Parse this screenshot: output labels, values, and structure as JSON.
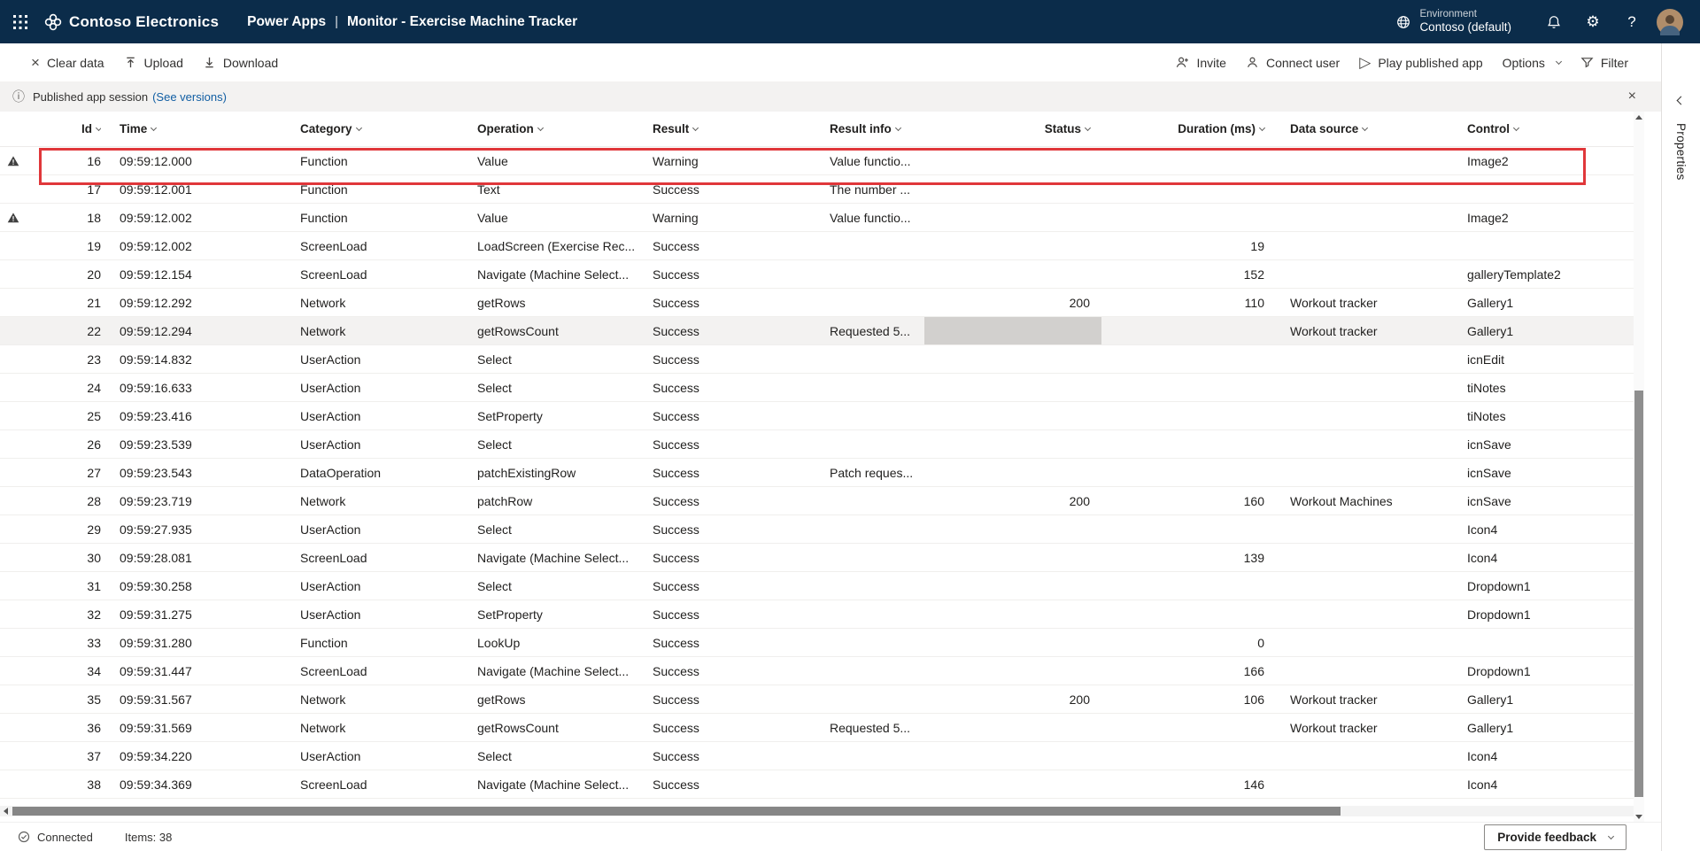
{
  "topbar": {
    "brand": "Contoso Electronics",
    "product": "Power Apps",
    "divider": "|",
    "page_title": "Monitor - Exercise Machine Tracker",
    "environment": {
      "label": "Environment",
      "name": "Contoso (default)"
    },
    "help": "?"
  },
  "toolbar": {
    "clear_data": "Clear data",
    "upload": "Upload",
    "download": "Download",
    "invite": "Invite",
    "connect_user": "Connect user",
    "play_published_app": "Play published app",
    "options": "Options",
    "filter": "Filter"
  },
  "infobar": {
    "message": "Published app session",
    "link": "(See versions)"
  },
  "table": {
    "columns": [
      "Id",
      "Time",
      "Category",
      "Operation",
      "Result",
      "Result info",
      "Status",
      "Duration (ms)",
      "Data source",
      "Control"
    ],
    "rows": [
      {
        "warning": true,
        "id": "16",
        "time": "09:59:12.000",
        "category": "Function",
        "operation": "Value",
        "result": "Warning",
        "result_info": "Value functio...",
        "status": "",
        "duration": "",
        "data_source": "",
        "control": "Image2"
      },
      {
        "warning": false,
        "id": "17",
        "time": "09:59:12.001",
        "category": "Function",
        "operation": "Text",
        "result": "Success",
        "result_info": "The number ...",
        "status": "",
        "duration": "",
        "data_source": "",
        "control": ""
      },
      {
        "warning": true,
        "id": "18",
        "time": "09:59:12.002",
        "category": "Function",
        "operation": "Value",
        "result": "Warning",
        "result_info": "Value functio...",
        "status": "",
        "duration": "",
        "data_source": "",
        "control": "Image2"
      },
      {
        "warning": false,
        "id": "19",
        "time": "09:59:12.002",
        "category": "ScreenLoad",
        "operation": "LoadScreen (Exercise Rec...",
        "result": "Success",
        "result_info": "",
        "status": "",
        "duration": "19",
        "data_source": "",
        "control": ""
      },
      {
        "warning": false,
        "id": "20",
        "time": "09:59:12.154",
        "category": "ScreenLoad",
        "operation": "Navigate (Machine Select...",
        "result": "Success",
        "result_info": "",
        "status": "",
        "duration": "152",
        "data_source": "",
        "control": "galleryTemplate2"
      },
      {
        "warning": false,
        "id": "21",
        "time": "09:59:12.292",
        "category": "Network",
        "operation": "getRows",
        "result": "Success",
        "result_info": "",
        "status": "200",
        "duration": "110",
        "data_source": "Workout tracker",
        "control": "Gallery1"
      },
      {
        "warning": false,
        "id": "22",
        "time": "09:59:12.294",
        "category": "Network",
        "operation": "getRowsCount",
        "result": "Success",
        "result_info": "Requested 5...",
        "status": "",
        "duration": "",
        "data_source": "Workout tracker",
        "control": "Gallery1",
        "selected": true,
        "selected_cell": "status"
      },
      {
        "warning": false,
        "id": "23",
        "time": "09:59:14.832",
        "category": "UserAction",
        "operation": "Select",
        "result": "Success",
        "result_info": "",
        "status": "",
        "duration": "",
        "data_source": "",
        "control": "icnEdit"
      },
      {
        "warning": false,
        "id": "24",
        "time": "09:59:16.633",
        "category": "UserAction",
        "operation": "Select",
        "result": "Success",
        "result_info": "",
        "status": "",
        "duration": "",
        "data_source": "",
        "control": "tiNotes"
      },
      {
        "warning": false,
        "id": "25",
        "time": "09:59:23.416",
        "category": "UserAction",
        "operation": "SetProperty",
        "result": "Success",
        "result_info": "",
        "status": "",
        "duration": "",
        "data_source": "",
        "control": "tiNotes"
      },
      {
        "warning": false,
        "id": "26",
        "time": "09:59:23.539",
        "category": "UserAction",
        "operation": "Select",
        "result": "Success",
        "result_info": "",
        "status": "",
        "duration": "",
        "data_source": "",
        "control": "icnSave"
      },
      {
        "warning": false,
        "id": "27",
        "time": "09:59:23.543",
        "category": "DataOperation",
        "operation": "patchExistingRow",
        "result": "Success",
        "result_info": "Patch reques...",
        "status": "",
        "duration": "",
        "data_source": "",
        "control": "icnSave"
      },
      {
        "warning": false,
        "id": "28",
        "time": "09:59:23.719",
        "category": "Network",
        "operation": "patchRow",
        "result": "Success",
        "result_info": "",
        "status": "200",
        "duration": "160",
        "data_source": "Workout Machines",
        "control": "icnSave"
      },
      {
        "warning": false,
        "id": "29",
        "time": "09:59:27.935",
        "category": "UserAction",
        "operation": "Select",
        "result": "Success",
        "result_info": "",
        "status": "",
        "duration": "",
        "data_source": "",
        "control": "Icon4"
      },
      {
        "warning": false,
        "id": "30",
        "time": "09:59:28.081",
        "category": "ScreenLoad",
        "operation": "Navigate (Machine Select...",
        "result": "Success",
        "result_info": "",
        "status": "",
        "duration": "139",
        "data_source": "",
        "control": "Icon4"
      },
      {
        "warning": false,
        "id": "31",
        "time": "09:59:30.258",
        "category": "UserAction",
        "operation": "Select",
        "result": "Success",
        "result_info": "",
        "status": "",
        "duration": "",
        "data_source": "",
        "control": "Dropdown1"
      },
      {
        "warning": false,
        "id": "32",
        "time": "09:59:31.275",
        "category": "UserAction",
        "operation": "SetProperty",
        "result": "Success",
        "result_info": "",
        "status": "",
        "duration": "",
        "data_source": "",
        "control": "Dropdown1"
      },
      {
        "warning": false,
        "id": "33",
        "time": "09:59:31.280",
        "category": "Function",
        "operation": "LookUp",
        "result": "Success",
        "result_info": "",
        "status": "",
        "duration": "0",
        "data_source": "",
        "control": ""
      },
      {
        "warning": false,
        "id": "34",
        "time": "09:59:31.447",
        "category": "ScreenLoad",
        "operation": "Navigate (Machine Select...",
        "result": "Success",
        "result_info": "",
        "status": "",
        "duration": "166",
        "data_source": "",
        "control": "Dropdown1"
      },
      {
        "warning": false,
        "id": "35",
        "time": "09:59:31.567",
        "category": "Network",
        "operation": "getRows",
        "result": "Success",
        "result_info": "",
        "status": "200",
        "duration": "106",
        "data_source": "Workout tracker",
        "control": "Gallery1"
      },
      {
        "warning": false,
        "id": "36",
        "time": "09:59:31.569",
        "category": "Network",
        "operation": "getRowsCount",
        "result": "Success",
        "result_info": "Requested 5...",
        "status": "",
        "duration": "",
        "data_source": "Workout tracker",
        "control": "Gallery1"
      },
      {
        "warning": false,
        "id": "37",
        "time": "09:59:34.220",
        "category": "UserAction",
        "operation": "Select",
        "result": "Success",
        "result_info": "",
        "status": "",
        "duration": "",
        "data_source": "",
        "control": "Icon4"
      },
      {
        "warning": false,
        "id": "38",
        "time": "09:59:34.369",
        "category": "ScreenLoad",
        "operation": "Navigate (Machine Select...",
        "result": "Success",
        "result_info": "",
        "status": "",
        "duration": "146",
        "data_source": "",
        "control": "Icon4"
      }
    ]
  },
  "statusbar": {
    "connection": "Connected",
    "items": "Items: 38",
    "feedback_button": "Provide feedback"
  },
  "properties_panel": {
    "title": "Properties"
  }
}
